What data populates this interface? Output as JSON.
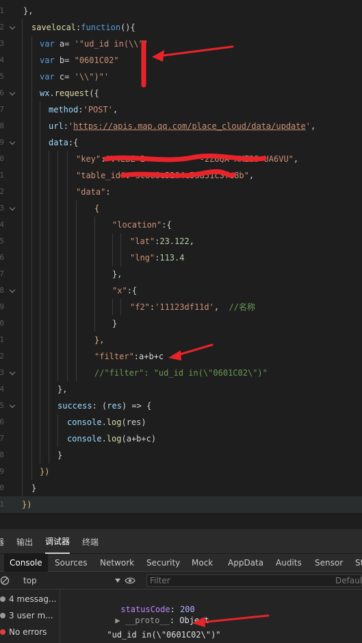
{
  "editor": {
    "line_numbers": [
      "1",
      "2",
      "3",
      "4",
      "5",
      "6",
      "7",
      "8",
      "9",
      "0",
      "1",
      "2",
      "3",
      "4",
      "5",
      "6",
      "7",
      "8",
      "9",
      "0",
      "1",
      "2",
      "3",
      "4",
      "5",
      "6",
      "7",
      "8",
      "9",
      "0",
      "1"
    ],
    "lines": [
      {
        "tokens": [
          {
            "t": "},",
            "c": "plain"
          }
        ]
      },
      {
        "tokens": [
          {
            "t": "savelocal",
            "c": "func"
          },
          {
            "t": ":",
            "c": "plain"
          },
          {
            "t": "function",
            "c": "blue"
          },
          {
            "t": "(){",
            "c": "plain"
          }
        ]
      },
      {
        "tokens": [
          {
            "t": "var",
            "c": "blue"
          },
          {
            "t": " a= ",
            "c": "plain"
          },
          {
            "t": "'\"ud_id in(\\\\\"'",
            "c": "str"
          }
        ]
      },
      {
        "tokens": [
          {
            "t": "var",
            "c": "blue"
          },
          {
            "t": " b= ",
            "c": "plain"
          },
          {
            "t": "\"0601C02\"",
            "c": "str"
          }
        ]
      },
      {
        "tokens": [
          {
            "t": "var",
            "c": "blue"
          },
          {
            "t": " c= ",
            "c": "plain"
          },
          {
            "t": "'\\\\\")\"'",
            "c": "str"
          }
        ]
      },
      {
        "tokens": [
          {
            "t": "wx",
            "c": "key"
          },
          {
            "t": ".",
            "c": "plain"
          },
          {
            "t": "request",
            "c": "fn"
          },
          {
            "t": "({",
            "c": "plain"
          }
        ]
      },
      {
        "tokens": [
          {
            "t": "method",
            "c": "key"
          },
          {
            "t": ":",
            "c": "plain"
          },
          {
            "t": "'POST'",
            "c": "str"
          },
          {
            "t": ",",
            "c": "plain"
          }
        ]
      },
      {
        "tokens": [
          {
            "t": "url",
            "c": "key"
          },
          {
            "t": ":",
            "c": "plain"
          },
          {
            "t": "'",
            "c": "str"
          },
          {
            "t": "https://apis.map.qq.com/place_cloud/data/update",
            "c": "link"
          },
          {
            "t": "'",
            "c": "str"
          },
          {
            "t": ",",
            "c": "plain"
          }
        ]
      },
      {
        "tokens": [
          {
            "t": "data",
            "c": "key"
          },
          {
            "t": ":{",
            "c": "plain"
          }
        ]
      },
      {
        "tokens": [
          {
            "t": "\"key\"",
            "c": "str"
          },
          {
            "t": ":",
            "c": "plain"
          },
          {
            "t": "\"V4ZBZ-2           -2Z6QA-XKZ2S-UA6VU\"",
            "c": "str"
          },
          {
            "t": ",",
            "c": "plain"
          }
        ]
      },
      {
        "tokens": [
          {
            "t": "\"table_id\"",
            "c": "str"
          },
          {
            "t": ":",
            "c": "plain"
          },
          {
            "t": "\"5c8e8c5204c53a51c3fe8b\"",
            "c": "str"
          },
          {
            "t": ",",
            "c": "plain"
          }
        ]
      },
      {
        "tokens": [
          {
            "t": "\"data\"",
            "c": "str"
          },
          {
            "t": ":",
            "c": "plain"
          }
        ]
      },
      {
        "tokens": [
          {
            "t": "{",
            "c": "par"
          }
        ]
      },
      {
        "tokens": [
          {
            "t": "\"location\"",
            "c": "str"
          },
          {
            "t": ":{",
            "c": "plain"
          }
        ]
      },
      {
        "tokens": [
          {
            "t": "\"lat\"",
            "c": "str"
          },
          {
            "t": ":",
            "c": "plain"
          },
          {
            "t": "23.122",
            "c": "num"
          },
          {
            "t": ",",
            "c": "plain"
          }
        ]
      },
      {
        "tokens": [
          {
            "t": "\"lng\"",
            "c": "str"
          },
          {
            "t": ":",
            "c": "plain"
          },
          {
            "t": "113.4",
            "c": "num"
          }
        ]
      },
      {
        "tokens": [
          {
            "t": "},",
            "c": "plain"
          }
        ]
      },
      {
        "tokens": [
          {
            "t": "\"x\"",
            "c": "str"
          },
          {
            "t": ":{",
            "c": "plain"
          }
        ]
      },
      {
        "tokens": [
          {
            "t": "\"f2\"",
            "c": "str"
          },
          {
            "t": ":",
            "c": "plain"
          },
          {
            "t": "'11123df11d'",
            "c": "str"
          },
          {
            "t": ",  ",
            "c": "plain"
          },
          {
            "t": "//名称",
            "c": "com"
          }
        ]
      },
      {
        "tokens": [
          {
            "t": "}",
            "c": "plain"
          }
        ]
      },
      {
        "tokens": [
          {
            "t": "},",
            "c": "par"
          }
        ]
      },
      {
        "tokens": [
          {
            "t": "\"filter\"",
            "c": "str"
          },
          {
            "t": ":a+b+c",
            "c": "plain"
          }
        ]
      },
      {
        "tokens": [
          {
            "t": "//\"filter\": \"ud_id in(\\\"0601C02\\\")\"",
            "c": "com"
          }
        ]
      },
      {
        "tokens": [
          {
            "t": "},",
            "c": "plain"
          }
        ]
      },
      {
        "tokens": [
          {
            "t": "success",
            "c": "key"
          },
          {
            "t": ": (",
            "c": "plain"
          },
          {
            "t": "res",
            "c": "key"
          },
          {
            "t": ") => {",
            "c": "plain"
          }
        ]
      },
      {
        "tokens": [
          {
            "t": "console",
            "c": "key"
          },
          {
            "t": ".",
            "c": "plain"
          },
          {
            "t": "log",
            "c": "fn"
          },
          {
            "t": "(res)",
            "c": "plain"
          }
        ]
      },
      {
        "tokens": [
          {
            "t": "console",
            "c": "key"
          },
          {
            "t": ".",
            "c": "plain"
          },
          {
            "t": "log",
            "c": "fn"
          },
          {
            "t": "(a+b+c)",
            "c": "plain"
          }
        ]
      },
      {
        "tokens": [
          {
            "t": "}",
            "c": "plain"
          }
        ]
      },
      {
        "tokens": [
          {
            "t": "})",
            "c": "par"
          }
        ]
      },
      {
        "tokens": [
          {
            "t": "}",
            "c": "plain"
          }
        ]
      },
      {
        "tokens": [
          {
            "t": "})",
            "c": "par"
          }
        ]
      }
    ]
  },
  "devtools": {
    "top_tabs": [
      "器",
      "输出",
      "调试器",
      "终端"
    ],
    "active_top_tab": "调试器",
    "panel_tabs": [
      "Console",
      "Sources",
      "Network",
      "Security",
      "Mock",
      "AppData",
      "Audits",
      "Sensor",
      "St"
    ],
    "active_panel_tab": "Console",
    "context": "top",
    "filter_placeholder": "Filter",
    "default_levels": "Default",
    "sidebar": [
      "4 messag...",
      "3 user m...",
      "No errors"
    ],
    "console_lines": {
      "status_key": "statusCode",
      "status_val": "200",
      "proto_key": "__proto__",
      "proto_val": "Object",
      "output": "\"ud_id in(\\\"0601C02\\\")\"",
      "prompt": "›"
    }
  },
  "colors": {
    "editor_bg": "#1e1e1e",
    "arrow_red": "#e8242a",
    "string": "#ce9178",
    "keyword": "#569cd6"
  }
}
